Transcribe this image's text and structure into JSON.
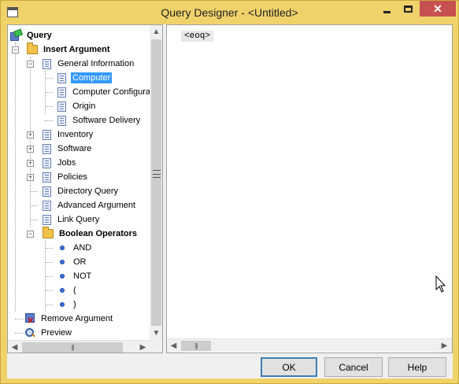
{
  "window": {
    "title": "Query Designer - <Untitled>",
    "accent_color": "#f0d26a",
    "close_color": "#c75050"
  },
  "tree": {
    "items": [
      {
        "label": "Query",
        "icon": "query-icon",
        "bold": true
      },
      {
        "label": "Insert Argument",
        "icon": "folder-icon",
        "bold": true
      },
      {
        "label": "General Information",
        "icon": "document-icon"
      },
      {
        "label": "Computer",
        "icon": "document-icon",
        "selected": true
      },
      {
        "label": "Computer Configura",
        "icon": "document-icon"
      },
      {
        "label": "Origin",
        "icon": "document-icon"
      },
      {
        "label": "Software Delivery",
        "icon": "document-icon"
      },
      {
        "label": "Inventory",
        "icon": "document-icon"
      },
      {
        "label": "Software",
        "icon": "document-icon"
      },
      {
        "label": "Jobs",
        "icon": "document-icon"
      },
      {
        "label": "Policies",
        "icon": "document-icon"
      },
      {
        "label": "Directory Query",
        "icon": "document-icon"
      },
      {
        "label": "Advanced Argument",
        "icon": "document-icon"
      },
      {
        "label": "Link Query",
        "icon": "document-icon"
      },
      {
        "label": "Boolean Operators",
        "icon": "folder-icon",
        "bold": true
      },
      {
        "label": "AND",
        "icon": "bullet-icon"
      },
      {
        "label": "OR",
        "icon": "bullet-icon"
      },
      {
        "label": "NOT",
        "icon": "bullet-icon"
      },
      {
        "label": "(",
        "icon": "bullet-icon"
      },
      {
        "label": ")",
        "icon": "bullet-icon"
      },
      {
        "label": "Remove Argument",
        "icon": "remove-icon"
      },
      {
        "label": "Preview",
        "icon": "preview-icon"
      }
    ]
  },
  "editor": {
    "token": "<eoq>"
  },
  "buttons": {
    "ok": "OK",
    "cancel": "Cancel",
    "help": "Help"
  },
  "icons": {
    "minimize": "minimize-icon",
    "maximize": "maximize-icon",
    "close": "close-icon"
  }
}
